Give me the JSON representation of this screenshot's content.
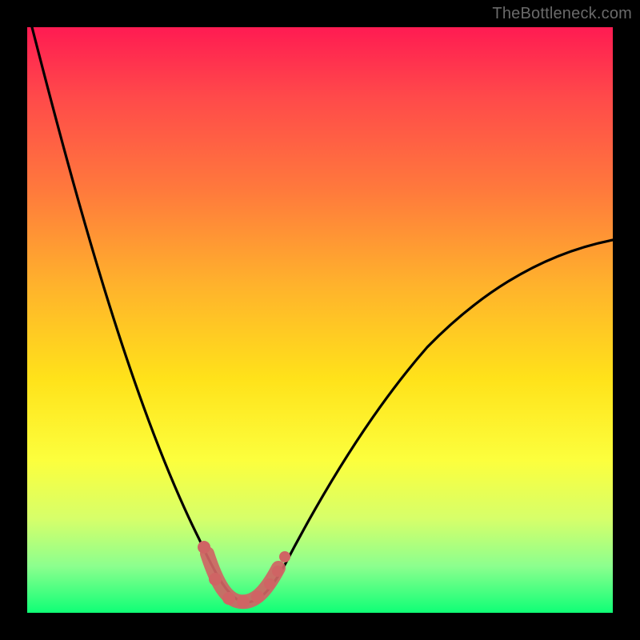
{
  "watermark": "TheBottleneck.com",
  "chart_data": {
    "type": "line",
    "title": "",
    "xlabel": "",
    "ylabel": "",
    "xlim": [
      0,
      100
    ],
    "ylim": [
      0,
      100
    ],
    "grid": false,
    "series": [
      {
        "name": "bottleneck-curve",
        "x": [
          0,
          5,
          10,
          15,
          20,
          25,
          28,
          30,
          32,
          34,
          36,
          38,
          40,
          45,
          50,
          55,
          60,
          65,
          70,
          75,
          80,
          85,
          90,
          95,
          100
        ],
        "y": [
          100,
          82,
          65,
          49,
          34,
          20,
          12,
          7,
          3,
          1,
          0,
          0,
          1,
          5,
          12,
          20,
          28,
          35,
          42,
          48,
          53,
          57,
          60,
          62,
          63
        ],
        "color": "#000000"
      }
    ],
    "markers": {
      "name": "highlighted-range",
      "color": "#d26a6a",
      "x": [
        28,
        30,
        32,
        34,
        36,
        38,
        40,
        42
      ],
      "y": [
        8,
        3.5,
        1.2,
        0.4,
        0.4,
        1.0,
        2.2,
        4.5
      ]
    }
  },
  "frame": {
    "outer_size_px": 800,
    "border_px": 34,
    "gradient_stops": [
      "#ff1b52",
      "#ff7a3c",
      "#ffe21a",
      "#0fff76"
    ]
  }
}
